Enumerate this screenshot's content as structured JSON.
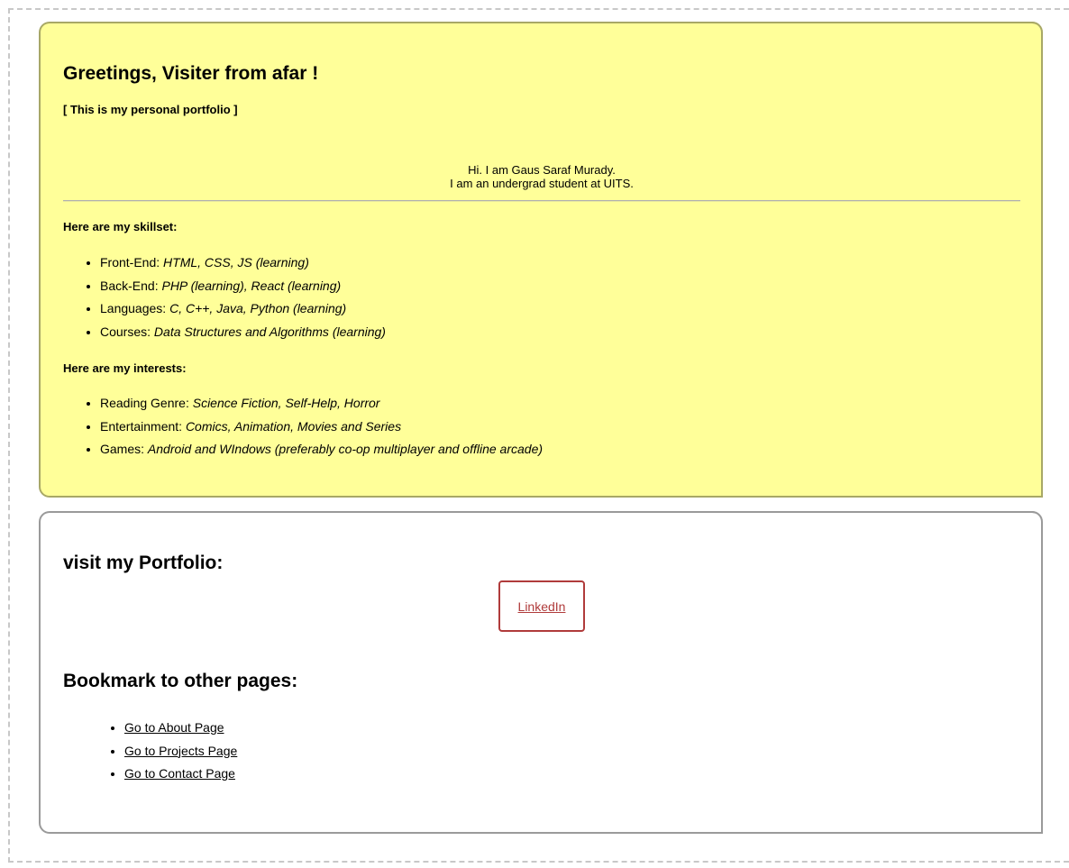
{
  "intro": {
    "greeting": "Greetings, Visiter from afar !",
    "subtitle": "[ This is my personal portfolio ]",
    "bio_line1": "Hi. I am Gaus Saraf Murady.",
    "bio_line2": "I am an undergrad student at UITS.",
    "skills_heading": "Here are my skillset:",
    "skills": [
      {
        "label": "Front-End: ",
        "value": "HTML, CSS, JS (learning)"
      },
      {
        "label": "Back-End: ",
        "value": "PHP (learning), React (learning)"
      },
      {
        "label": "Languages: ",
        "value": "C, C++, Java, Python (learning)"
      },
      {
        "label": "Courses: ",
        "value": "Data Structures and Algorithms (learning)"
      }
    ],
    "interests_heading": "Here are my interests:",
    "interests": [
      {
        "label": "Reading Genre: ",
        "value": "Science Fiction, Self-Help, Horror"
      },
      {
        "label": "Entertainment: ",
        "value": "Comics, Animation, Movies and Series"
      },
      {
        "label": "Games: ",
        "value": "Android and WIndows (preferably co-op multiplayer and offline arcade)"
      }
    ]
  },
  "links": {
    "portfolio_heading": "visit my Portfolio:",
    "linkedin_label": "LinkedIn",
    "bookmark_heading": "Bookmark to other pages:",
    "bookmarks": [
      {
        "label": "Go to About Page"
      },
      {
        "label": "Go to Projects Page"
      },
      {
        "label": "Go to Contact Page"
      }
    ]
  },
  "colors": {
    "intro_bg": "#ffff99",
    "link_accent": "#b03b3b"
  }
}
